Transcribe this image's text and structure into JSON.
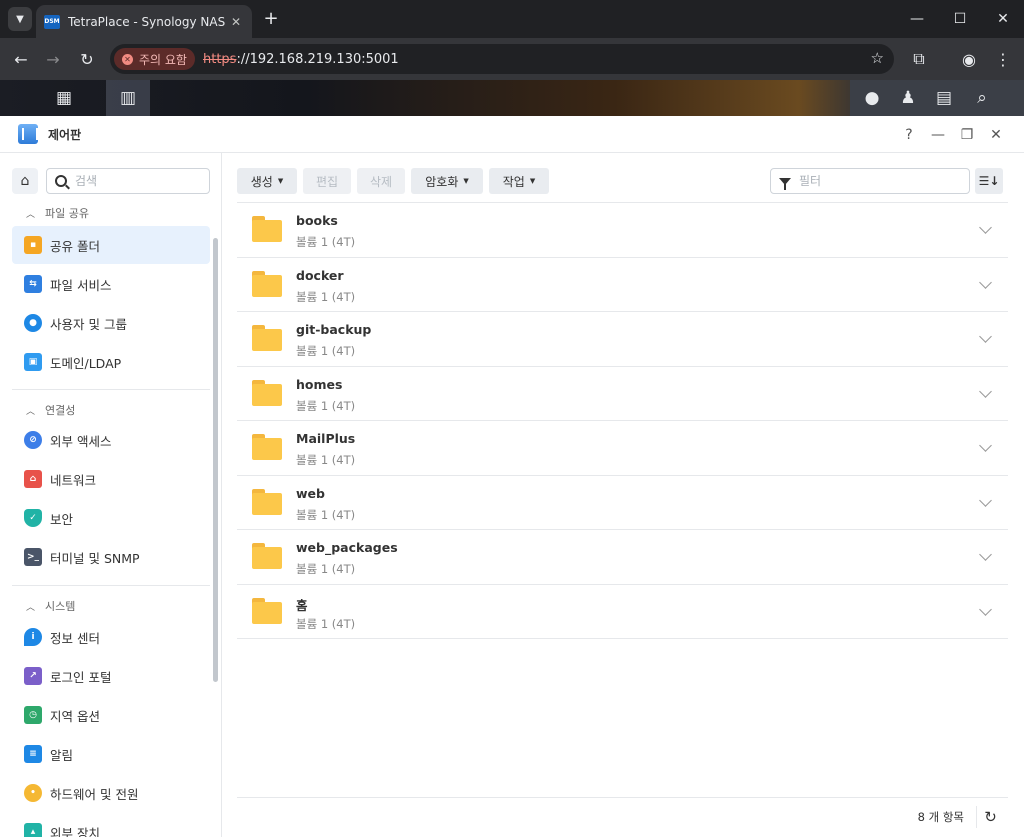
{
  "browser": {
    "tab_title": "TetraPlace - Synology NAS",
    "tab_favicon_text": "DSM",
    "security_label": "주의 요함",
    "url_scheme": "https",
    "url_rest": "://192.168.219.130:5001"
  },
  "window": {
    "title": "제어판",
    "help": "?"
  },
  "sidebar": {
    "search_placeholder": "검색",
    "sections": [
      {
        "title": "파일 공유",
        "items": [
          {
            "label": "공유 폴더",
            "icon": "shared-folder-icon",
            "color": "#f5a623",
            "active": true
          },
          {
            "label": "파일 서비스",
            "icon": "file-services-icon",
            "color": "#2f7fe0"
          },
          {
            "label": "사용자 및 그룹",
            "icon": "users-groups-icon",
            "color": "#1e88e5"
          },
          {
            "label": "도메인/LDAP",
            "icon": "domain-ldap-icon",
            "color": "#2f9bf0"
          }
        ]
      },
      {
        "title": "연결성",
        "items": [
          {
            "label": "외부 액세스",
            "icon": "external-access-icon",
            "color": "#3d7ee8"
          },
          {
            "label": "네트워크",
            "icon": "network-icon",
            "color": "#e8524a"
          },
          {
            "label": "보안",
            "icon": "security-shield-icon",
            "color": "#21b3a6"
          },
          {
            "label": "터미널 및 SNMP",
            "icon": "terminal-icon",
            "color": "#4a5568"
          }
        ]
      },
      {
        "title": "시스템",
        "items": [
          {
            "label": "정보 센터",
            "icon": "info-center-icon",
            "color": "#1e88e5"
          },
          {
            "label": "로그인 포털",
            "icon": "login-portal-icon",
            "color": "#7b5fc9"
          },
          {
            "label": "지역 옵션",
            "icon": "regional-options-icon",
            "color": "#2ea86b"
          },
          {
            "label": "알림",
            "icon": "notification-icon",
            "color": "#1e88e5"
          },
          {
            "label": "하드웨어 및 전원",
            "icon": "hardware-power-icon",
            "color": "#f5b833"
          },
          {
            "label": "외부 장치",
            "icon": "external-devices-icon",
            "color": "#21b3a6"
          }
        ]
      }
    ]
  },
  "toolbar": {
    "create": "생성",
    "edit": "편집",
    "delete": "삭제",
    "encrypt": "암호화",
    "action": "작업",
    "filter_placeholder": "필터"
  },
  "folders": [
    {
      "name": "books",
      "volume": "볼륨 1 (4T)"
    },
    {
      "name": "docker",
      "volume": "볼륨 1 (4T)"
    },
    {
      "name": "git-backup",
      "volume": "볼륨 1 (4T)"
    },
    {
      "name": "homes",
      "volume": "볼륨 1 (4T)"
    },
    {
      "name": "MailPlus",
      "volume": "볼륨 1 (4T)"
    },
    {
      "name": "web",
      "volume": "볼륨 1 (4T)"
    },
    {
      "name": "web_packages",
      "volume": "볼륨 1 (4T)"
    },
    {
      "name": "홈",
      "volume": "볼륨 1 (4T)"
    }
  ],
  "footer": {
    "item_count": "8 개 항목"
  }
}
